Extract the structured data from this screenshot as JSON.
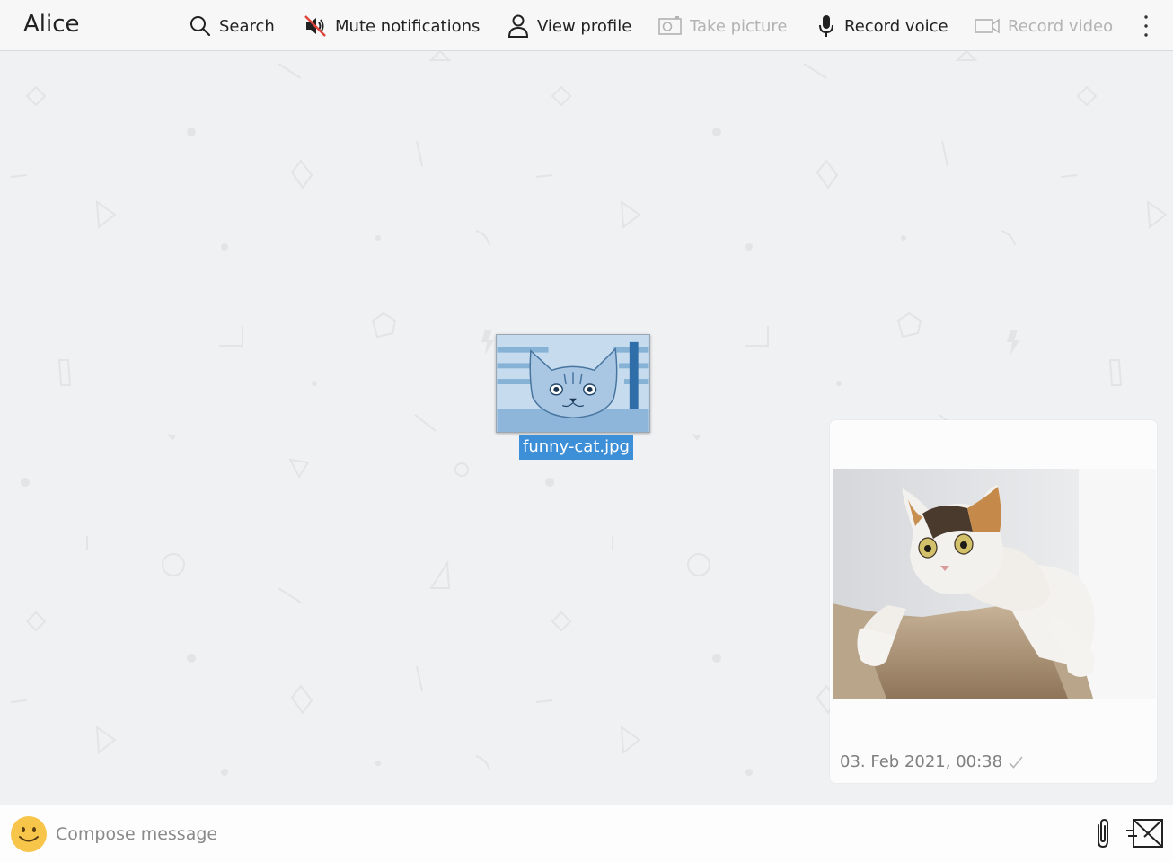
{
  "header": {
    "chat_title": "Alice",
    "actions": {
      "search": "Search",
      "mute": "Mute notifications",
      "profile": "View profile",
      "take_picture": "Take picture",
      "record_voice": "Record voice",
      "record_video": "Record video"
    },
    "more_icon": "vertical-dots-icon"
  },
  "drag_ghost": {
    "filename": "funny-cat.jpg"
  },
  "message": {
    "timestamp": "03. Feb 2021, 00:38",
    "status_icon": "checkmark-icon"
  },
  "composer": {
    "placeholder": "Compose message",
    "value": ""
  },
  "colors": {
    "background": "#f0f1f3",
    "header_bg": "#f7f7f8",
    "selection": "#3d8fd8",
    "disabled_text": "#b3b3b3",
    "emoji_yellow": "#f7c54a"
  }
}
